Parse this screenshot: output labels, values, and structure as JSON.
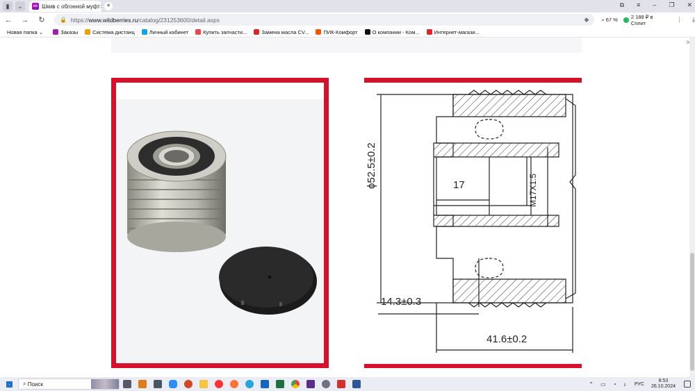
{
  "tab": {
    "title": "Шкив с обгонной муфт",
    "favicon": "wb-icon"
  },
  "address": {
    "url_prefix": "https://",
    "url_host": "www.wildberries.ru",
    "url_path": "/catalog/231253600/detail.aspx",
    "zoom": "67 %",
    "split": "2 188 ₽ в Сплит"
  },
  "bookmarks": [
    {
      "label": "Новая папка",
      "color": "#ffffff"
    },
    {
      "label": "Заказы",
      "color": "#a21caf"
    },
    {
      "label": "Система дистанц",
      "color": "#f59e0b"
    },
    {
      "label": "Личный кабинет",
      "color": "#0ea5e9"
    },
    {
      "label": "Купить запчасти...",
      "color": "#ef4444"
    },
    {
      "label": "Замена масла CV...",
      "color": "#dc2626"
    },
    {
      "label": "ПИК-Комфорт",
      "color": "#ea580c"
    },
    {
      "label": "О компании - Ком...",
      "color": "#111111"
    },
    {
      "label": "Интернет-магази...",
      "color": "#dc2626"
    }
  ],
  "drawing": {
    "dim_diameter": "ϕ52.5±0.2",
    "dim_thread": "M17X1.5",
    "dim_depth": "17",
    "dim_offset": "14.3±0.3",
    "dim_length": "41.6±0.2"
  },
  "taskbar": {
    "search_label": "Поиск",
    "lang": "РУС",
    "time": "8:53",
    "date": "26.10.2024"
  },
  "colors": {
    "accent_red": "#d6112b",
    "wb_purple": "#a21caf"
  }
}
